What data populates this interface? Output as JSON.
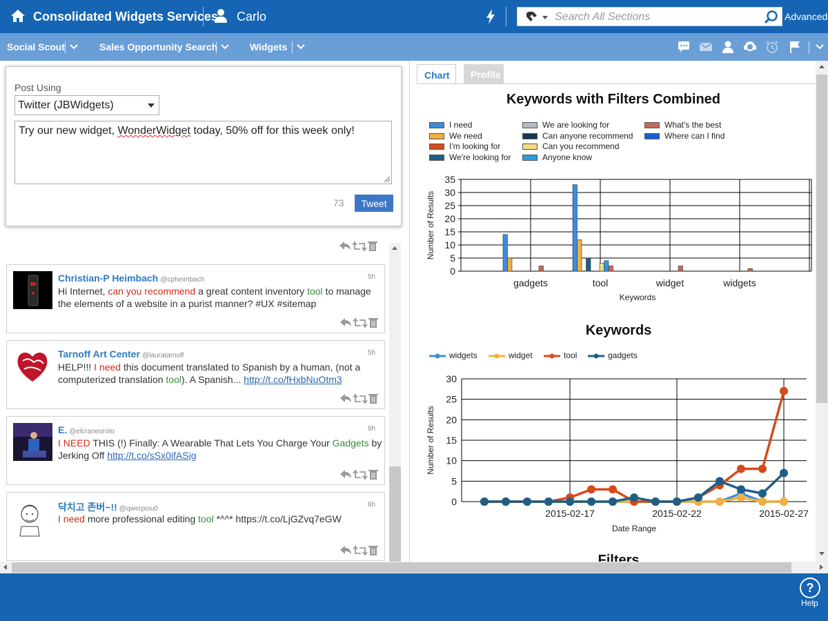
{
  "header": {
    "app_title": "Consolidated Widgets Services",
    "user_name": "Carlo",
    "search_placeholder": "Search All Sections",
    "advanced_label": "Advanced",
    "colors": {
      "primary": "#1565b4",
      "nav": "#6a9ed6"
    }
  },
  "nav": {
    "items": [
      "Social Scout",
      "Sales Opportunity Search",
      "Widgets"
    ],
    "icons": [
      "chat-icon",
      "mail-icon",
      "person-icon",
      "support-icon",
      "alarm-icon",
      "flag-icon",
      "chevron-down-icon"
    ]
  },
  "composer": {
    "post_using_label": "Post Using",
    "account_selected": "Twitter (JBWidgets)",
    "message_pre": "Try our new widget, ",
    "message_misspelled": "WonderWidget",
    "message_post": " today, 50% off for this week only!",
    "char_count": "73",
    "tweet_button": "Tweet"
  },
  "feed": {
    "items": [
      {
        "author": "Christian-P Heimbach",
        "handle": "@cpheimbach",
        "time": "5h",
        "parts": [
          {
            "t": "Hi Internet, ",
            "c": ""
          },
          {
            "t": "can you recommend",
            "c": "kw"
          },
          {
            "t": " a great content inventory ",
            "c": ""
          },
          {
            "t": "tool",
            "c": "kw2"
          },
          {
            "t": " to manage the elements of a website in a purist manner? #UX #sitemap",
            "c": ""
          }
        ]
      },
      {
        "author": "Tarnoff Art Center",
        "handle": "@lauratarnoff",
        "time": "5h",
        "parts": [
          {
            "t": "HELP!!! ",
            "c": ""
          },
          {
            "t": "I need",
            "c": "kw"
          },
          {
            "t": " this document translated to Spanish by a human, (not a computerized translation ",
            "c": ""
          },
          {
            "t": "tool",
            "c": "kw2"
          },
          {
            "t": "). A Spanish... ",
            "c": ""
          },
          {
            "t": "http://t.co/fHxbNuOtm3",
            "c": "link"
          }
        ]
      },
      {
        "author": "E.",
        "handle": "@elcraneoroto",
        "time": "6h",
        "parts": [
          {
            "t": "I NEED",
            "c": "kw"
          },
          {
            "t": " THIS (!) Finally: A Wearable That Lets You Charge Your ",
            "c": ""
          },
          {
            "t": "Gadgets",
            "c": "kw2"
          },
          {
            "t": " by Jerking Off ",
            "c": ""
          },
          {
            "t": "http://t.co/sSx0ifASig",
            "c": "link"
          }
        ]
      },
      {
        "author": "닥치고 존버~!!",
        "handle": "@qwerpoiu0",
        "time": "6h",
        "parts": [
          {
            "t": "I need",
            "c": "kw"
          },
          {
            "t": " more professional editing ",
            "c": ""
          },
          {
            "t": "tool",
            "c": "kw2"
          },
          {
            "t": " *^^* https://t.co/LjGZvq7eGW",
            "c": ""
          }
        ]
      }
    ]
  },
  "right": {
    "tabs": [
      "Chart",
      "Profile"
    ],
    "next_section_title": "Filters"
  },
  "footer": {
    "help_label": "Help"
  },
  "chart_data": [
    {
      "type": "bar",
      "title": "Keywords with Filters Combined",
      "xlabel": "Keywords",
      "ylabel": "Number of Results",
      "ylim": [
        0,
        35
      ],
      "yticks": [
        0,
        5,
        10,
        15,
        20,
        25,
        30,
        35
      ],
      "categories": [
        "gadgets",
        "tool",
        "widget",
        "widgets"
      ],
      "legend_placement": "top",
      "grid": true,
      "series": [
        {
          "name": "I need",
          "color": "#3b8de0",
          "values": [
            14,
            33,
            0,
            0
          ]
        },
        {
          "name": "We need",
          "color": "#f0b040",
          "values": [
            5,
            12,
            0,
            0
          ]
        },
        {
          "name": "I'm looking for",
          "color": "#d64a1a",
          "values": [
            0,
            0,
            0,
            0
          ]
        },
        {
          "name": "We're looking for",
          "color": "#1f5e86",
          "values": [
            0,
            5,
            0,
            0
          ]
        },
        {
          "name": "We are looking for",
          "color": "#b8bcc4",
          "values": [
            0,
            0,
            0,
            0
          ]
        },
        {
          "name": "Can anyone recommend",
          "color": "#1a3556",
          "values": [
            0,
            0,
            0,
            0
          ]
        },
        {
          "name": "Can you recommend",
          "color": "#f5da86",
          "values": [
            0,
            3,
            0,
            0
          ]
        },
        {
          "name": "Anyone know",
          "color": "#2a9de0",
          "values": [
            0,
            4,
            0,
            0
          ]
        },
        {
          "name": "What's the best",
          "color": "#c86a5a",
          "values": [
            2,
            2,
            2,
            1
          ]
        },
        {
          "name": "Where can I find",
          "color": "#1a5fd0",
          "values": [
            0,
            0,
            0,
            0
          ]
        }
      ]
    },
    {
      "type": "line",
      "title": "Keywords",
      "xlabel": "Date Range",
      "ylabel": "Number of Results",
      "ylim": [
        0,
        30
      ],
      "yticks": [
        0,
        5,
        10,
        15,
        20,
        25,
        30
      ],
      "x": [
        "2015-02-13",
        "2015-02-14",
        "2015-02-15",
        "2015-02-16",
        "2015-02-17",
        "2015-02-18",
        "2015-02-19",
        "2015-02-20",
        "2015-02-21",
        "2015-02-22",
        "2015-02-23",
        "2015-02-24",
        "2015-02-25",
        "2015-02-26",
        "2015-02-27"
      ],
      "xtick_labels": [
        "2015-02-17",
        "2015-02-22",
        "2015-02-27"
      ],
      "legend_placement": "top",
      "grid": true,
      "series": [
        {
          "name": "widgets",
          "color": "#3b8de0",
          "values": [
            0,
            0,
            0,
            0,
            0,
            0,
            0,
            0,
            0,
            0,
            0,
            0,
            2,
            0,
            0
          ]
        },
        {
          "name": "widget",
          "color": "#f0b040",
          "values": [
            0,
            0,
            0,
            0,
            0,
            0,
            0,
            0,
            0,
            0,
            0,
            0,
            1,
            0,
            0
          ]
        },
        {
          "name": "tool",
          "color": "#d64a1a",
          "values": [
            0,
            0,
            0,
            0,
            1,
            3,
            3,
            0,
            0,
            0,
            1,
            4,
            8,
            8,
            27
          ]
        },
        {
          "name": "gadgets",
          "color": "#1f5e86",
          "values": [
            0,
            0,
            0,
            0,
            0,
            0,
            0,
            1,
            0,
            0,
            1,
            5,
            3,
            2,
            7
          ]
        }
      ]
    }
  ]
}
